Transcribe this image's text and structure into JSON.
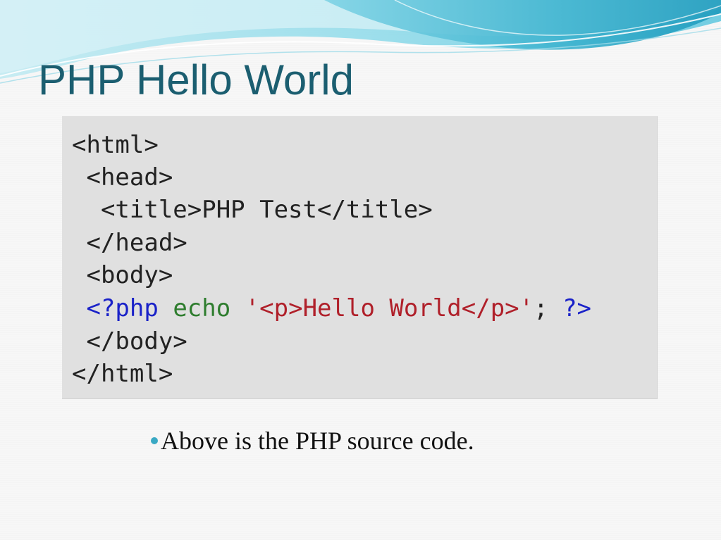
{
  "slide": {
    "title": "PHP Hello World",
    "code": {
      "lines": [
        "<html>",
        " <head>",
        "  <title>PHP Test</title>",
        " </head>",
        " <body>",
        "",
        " </body>",
        "</html>"
      ],
      "php_line": {
        "indent": " ",
        "open_tag": "<?php",
        "space1": " ",
        "keyword": "echo",
        "space2": " ",
        "string": "'<p>Hello World</p>'",
        "semicolon": ";",
        "space3": " ",
        "close_tag": "?>"
      }
    },
    "bullet": "Above is the PHP source code."
  },
  "colors": {
    "title": "#1b5e70",
    "code_background": "#e0e0e0",
    "php_tag": "#1a22c8",
    "keyword": "#2e7d2e",
    "string": "#b0202a",
    "bullet_dot": "#3aa9c4",
    "wave_light": "#a8e2ee",
    "wave_mid": "#6fcde0",
    "wave_dark": "#2aa6c6"
  },
  "icons": {
    "bullet": "bullet-dot-icon"
  }
}
